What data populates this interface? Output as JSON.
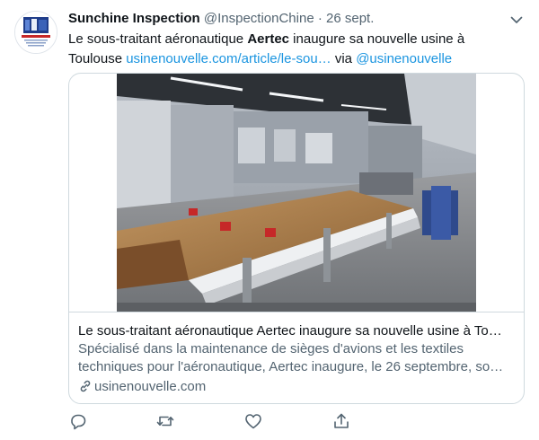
{
  "tweet": {
    "author_name": "Sunchine Inspection",
    "handle": "@InspectionChine",
    "separator": "·",
    "date": "26 sept.",
    "text_part1": "Le sous-traitant aéronautique ",
    "text_bold": "Aertec",
    "text_part2": " inaugure sa nouvelle usine à Toulouse ",
    "text_link": "usinenouvelle.com/article/le-sou…",
    "text_via": " via ",
    "text_mention": "@usinenouvelle",
    "avatar_text": "SUNCHINE INSPECTION"
  },
  "card": {
    "title": "Le sous-traitant aéronautique Aertec inaugure sa nouvelle usine à To…",
    "description_line1": "Spécialisé dans la maintenance de sièges d'avions et les textiles",
    "description_line2": "techniques pour l'aéronautique, Aertec inaugure, le 26 septembre, so…",
    "domain": "usinenouvelle.com"
  },
  "icons": [
    "caret-down-icon",
    "link-icon",
    "reply-icon",
    "retweet-icon",
    "like-icon",
    "share-icon"
  ],
  "colors": {
    "link": "#1b95e0",
    "secondary": "#536471",
    "border": "#cfd9de"
  }
}
